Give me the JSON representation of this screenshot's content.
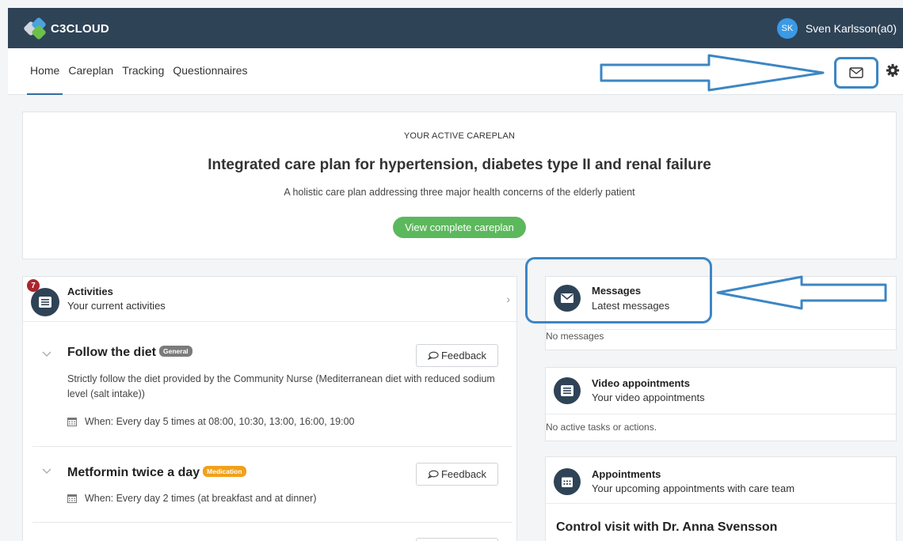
{
  "app": {
    "logo_text": "C3CLOUD"
  },
  "user": {
    "initials": "SK",
    "name": "Sven Karlsson(a0)"
  },
  "nav": {
    "tabs": [
      "Home",
      "Careplan",
      "Tracking",
      "Questionnaires"
    ]
  },
  "careplan": {
    "label": "YOUR ACTIVE CAREPLAN",
    "title": "Integrated care plan for hypertension, diabetes type II and renal failure",
    "description": "A holistic care plan addressing three major health concerns of the elderly patient",
    "button": "View complete careplan"
  },
  "activities": {
    "badge": "7",
    "title": "Activities",
    "subtitle": "Your current activities",
    "items": [
      {
        "title": "Follow the diet",
        "tag": "General",
        "feedback": "Feedback",
        "description": "Strictly follow the diet provided by the Community Nurse (Mediterranean diet with reduced sodium level (salt intake))",
        "when": "When: Every day 5 times at 08:00, 10:30, 13:00, 16:00, 19:00"
      },
      {
        "title": "Metformin twice a day",
        "tag": "Medication",
        "feedback": "Feedback",
        "when": "When: Every day 2 times (at breakfast and at dinner)"
      }
    ]
  },
  "messages": {
    "title": "Messages",
    "subtitle": "Latest messages",
    "empty": "No messages"
  },
  "video": {
    "title": "Video appointments",
    "subtitle": "Your video appointments",
    "empty": "No active tasks or actions."
  },
  "appointments": {
    "title": "Appointments",
    "subtitle": "Your upcoming appointments with care team",
    "first": "Control visit with Dr. Anna Svensson"
  },
  "colors": {
    "header": "#2f4357",
    "accent": "#3c86c4",
    "green": "#5cb85c",
    "medication_tag": "#f0a11b",
    "general_tag": "#7b7b7b",
    "badge": "#a8262c"
  }
}
